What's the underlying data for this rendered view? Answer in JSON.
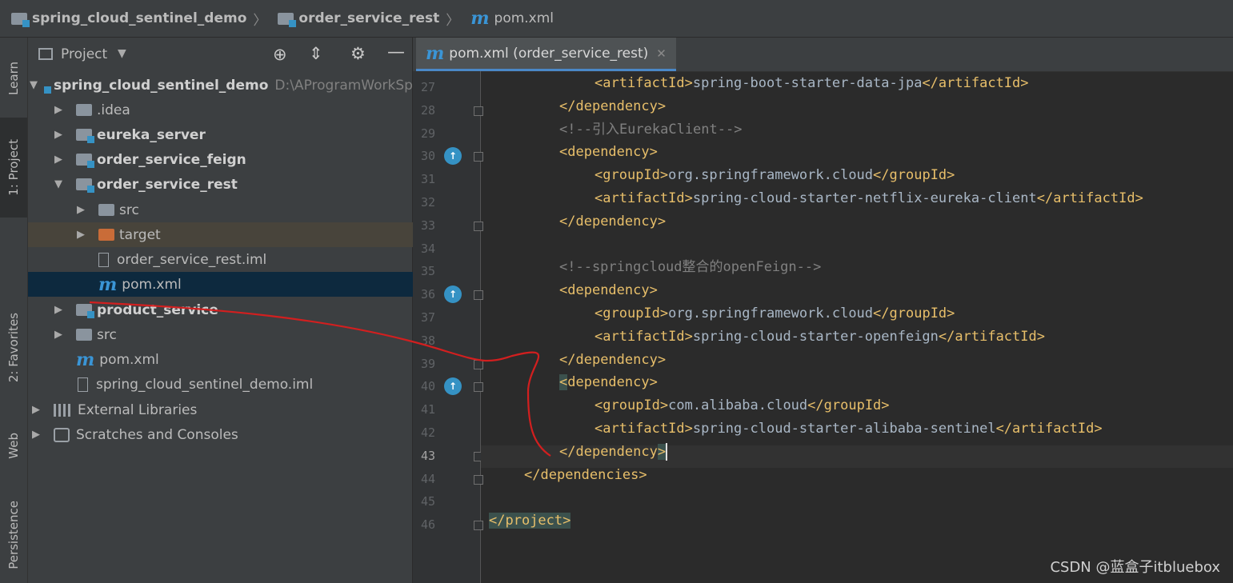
{
  "breadcrumb": {
    "items": [
      "spring_cloud_sentinel_demo",
      "order_service_rest",
      "pom.xml"
    ]
  },
  "tool_strip": {
    "tabs": [
      "Learn",
      "1: Project",
      "2: Favorites",
      "Web",
      "Persistence"
    ]
  },
  "project_panel": {
    "title": "Project",
    "tree": [
      {
        "label": "spring_cloud_sentinel_demo",
        "hint": "D:\\AProgramWorkSpa",
        "bold": true,
        "expanded": true,
        "depth": 0,
        "icon": "module-folder-icon"
      },
      {
        "label": ".idea",
        "depth": 1,
        "icon": "folder-icon"
      },
      {
        "label": "eureka_server",
        "bold": true,
        "depth": 1,
        "icon": "module-folder-icon"
      },
      {
        "label": "order_service_feign",
        "bold": true,
        "depth": 1,
        "icon": "module-folder-icon"
      },
      {
        "label": "order_service_rest",
        "bold": true,
        "expanded": true,
        "depth": 1,
        "icon": "module-folder-icon"
      },
      {
        "label": "src",
        "depth": 2,
        "icon": "folder-icon"
      },
      {
        "label": "target",
        "depth": 2,
        "icon": "excluded-folder-icon"
      },
      {
        "label": "order_service_rest.iml",
        "depth": 2,
        "icon": "iml-file-icon"
      },
      {
        "label": "pom.xml",
        "depth": 2,
        "icon": "maven-icon",
        "selected": true
      },
      {
        "label": "product_service",
        "bold": true,
        "depth": 1,
        "icon": "module-folder-icon"
      },
      {
        "label": "src",
        "depth": 1,
        "icon": "folder-icon"
      },
      {
        "label": "pom.xml",
        "depth": 1,
        "icon": "maven-icon"
      },
      {
        "label": "spring_cloud_sentinel_demo.iml",
        "depth": 1,
        "icon": "iml-file-icon"
      },
      {
        "label": "External Libraries",
        "depth": 0,
        "icon": "libraries-icon"
      },
      {
        "label": "Scratches and Consoles",
        "depth": 0,
        "icon": "scratches-icon"
      }
    ]
  },
  "editor": {
    "tab_label": "pom.xml (order_service_rest)",
    "current_line": 43,
    "lines": [
      {
        "n": 27,
        "indent": 3,
        "kind": "elem",
        "tag": "artifactId",
        "text": "spring-boot-starter-data-jpa"
      },
      {
        "n": 28,
        "indent": 2,
        "kind": "close",
        "tag": "dependency"
      },
      {
        "n": 29,
        "indent": 2,
        "kind": "comment",
        "text": "<!--引入EurekaClient-->"
      },
      {
        "n": 30,
        "indent": 2,
        "kind": "open",
        "tag": "dependency"
      },
      {
        "n": 31,
        "indent": 3,
        "kind": "elem",
        "tag": "groupId",
        "text": "org.springframework.cloud"
      },
      {
        "n": 32,
        "indent": 3,
        "kind": "elem",
        "tag": "artifactId",
        "text": "spring-cloud-starter-netflix-eureka-client"
      },
      {
        "n": 33,
        "indent": 2,
        "kind": "close",
        "tag": "dependency"
      },
      {
        "n": 34,
        "indent": 0,
        "kind": "blank"
      },
      {
        "n": 35,
        "indent": 2,
        "kind": "comment",
        "text": "<!--springcloud整合的openFeign-->"
      },
      {
        "n": 36,
        "indent": 2,
        "kind": "open",
        "tag": "dependency"
      },
      {
        "n": 37,
        "indent": 3,
        "kind": "elem",
        "tag": "groupId",
        "text": "org.springframework.cloud"
      },
      {
        "n": 38,
        "indent": 3,
        "kind": "elem",
        "tag": "artifactId",
        "text": "spring-cloud-starter-openfeign"
      },
      {
        "n": 39,
        "indent": 2,
        "kind": "close",
        "tag": "dependency"
      },
      {
        "n": 40,
        "indent": 2,
        "kind": "open",
        "tag": "dependency"
      },
      {
        "n": 41,
        "indent": 3,
        "kind": "elem",
        "tag": "groupId",
        "text": "com.alibaba.cloud"
      },
      {
        "n": 42,
        "indent": 3,
        "kind": "elem",
        "tag": "artifactId",
        "text": "spring-cloud-starter-alibaba-sentinel"
      },
      {
        "n": 43,
        "indent": 2,
        "kind": "close",
        "tag": "dependency"
      },
      {
        "n": 44,
        "indent": 1,
        "kind": "close",
        "tag": "dependencies"
      },
      {
        "n": 45,
        "indent": 0,
        "kind": "blank"
      },
      {
        "n": 46,
        "indent": 0,
        "kind": "close",
        "tag": "project"
      }
    ]
  },
  "watermark": "CSDN @蓝盒子itbluebox",
  "colors": {
    "tag": "#e8bf6a",
    "text": "#a9b7c6",
    "comment": "#808080",
    "selection": "#0d293e",
    "accent": "#3592c4"
  }
}
